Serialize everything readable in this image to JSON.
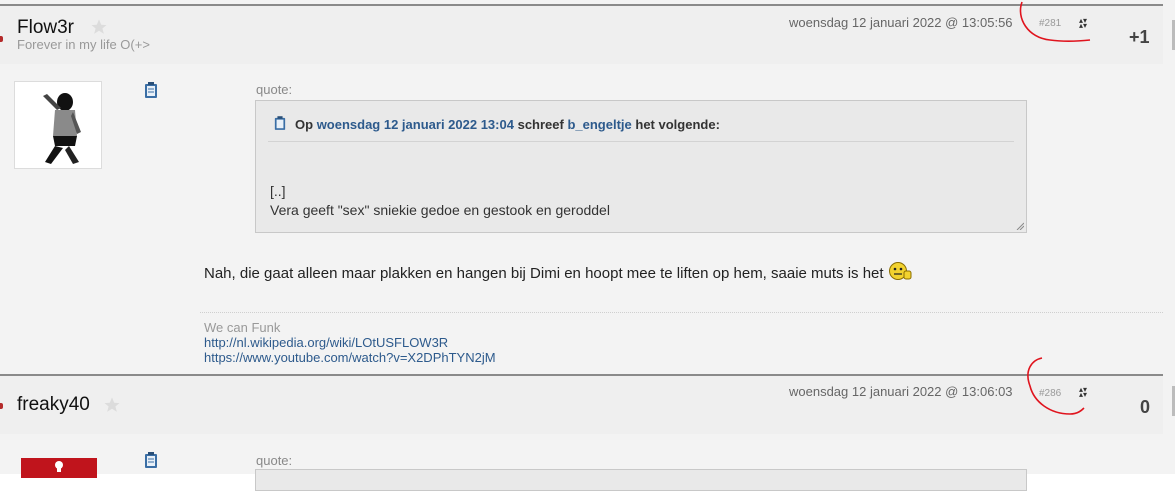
{
  "posts": [
    {
      "username": "Flow3r",
      "user_title": "Forever in my life O(+>",
      "date": "woensdag 12 januari 2022 @ 13:05:56",
      "post_number": "#281",
      "score": "+1",
      "quote": {
        "label": "quote:",
        "op": "Op",
        "date_link": "woensdag 12 januari 2022 13:04",
        "wrote": "schreef",
        "author": "b_engeltje",
        "tail": "het volgende:",
        "line1": "[..]",
        "line2": "Vera geeft \"sex\" sniekie gedoe en gestook en geroddel"
      },
      "body": "Nah, die gaat alleen maar plakken en hangen bij Dimi en hoopt mee te liften op hem, saaie muts is het",
      "signature": {
        "line1": "We can Funk",
        "link1": "http://nl.wikipedia.org/wiki/LOtUSFLOW3R",
        "link2": "https://www.youtube.com/watch?v=X2DPhTYN2jM"
      }
    },
    {
      "username": "freaky40",
      "date": "woensdag 12 januari 2022 @ 13:06:03",
      "post_number": "#286",
      "score": "0",
      "quote": {
        "label": "quote:"
      }
    }
  ],
  "icons": {
    "star": "star-icon",
    "vote": "vote-arrows-icon",
    "clipboard": "clipboard-icon",
    "smiley": "smiley-icon"
  },
  "colors": {
    "link": "#2d5a8c",
    "annotation": "#e0141e",
    "header_border": "#8a8a8a"
  }
}
